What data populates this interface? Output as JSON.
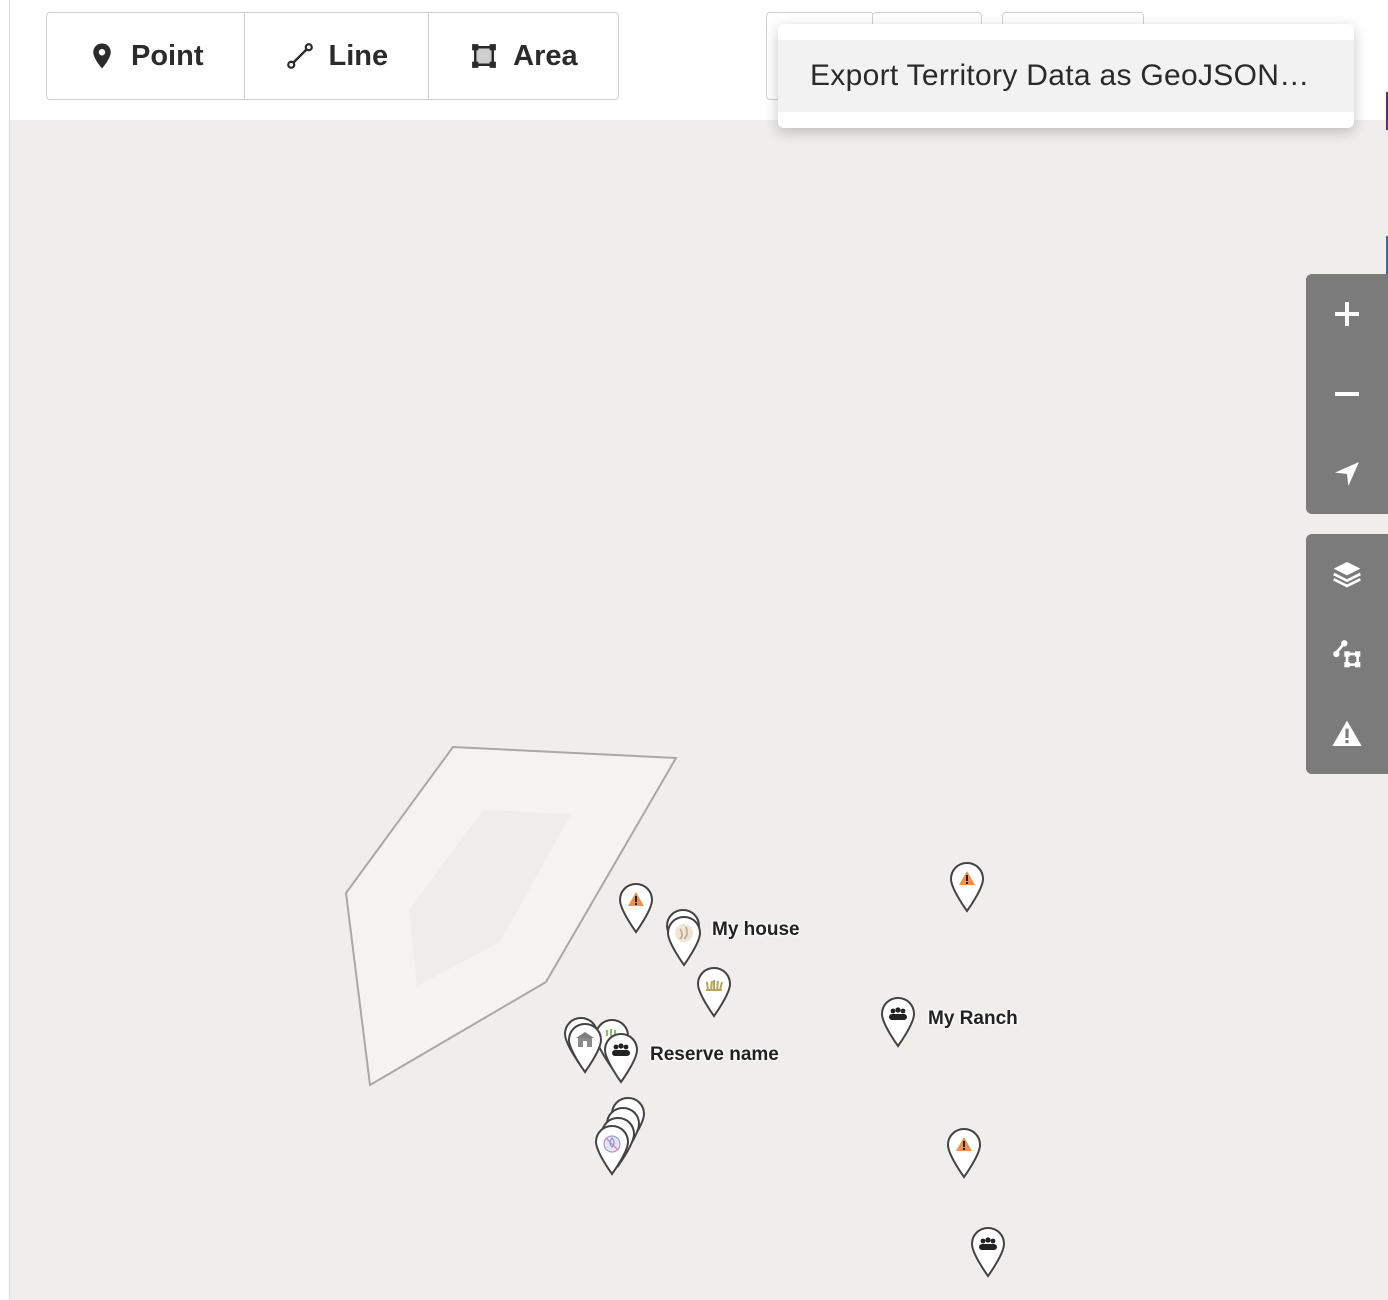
{
  "toolbar": {
    "draw_tools": [
      {
        "label": "Point",
        "icon": "map-pin-icon"
      },
      {
        "label": "Line",
        "icon": "line-icon"
      },
      {
        "label": "Area",
        "icon": "area-polygon-icon"
      }
    ]
  },
  "export_menu": {
    "items": [
      {
        "label": "Export Territory Data as GeoJSON…"
      }
    ]
  },
  "map": {
    "background_color": "#efeeea",
    "markers": [
      {
        "icon": "hazard-icon",
        "label": ""
      },
      {
        "icon": "house-icon",
        "label": "My house"
      },
      {
        "icon": "plant-icon",
        "label": ""
      },
      {
        "icon": "hazard-icon",
        "label": ""
      },
      {
        "icon": "community-icon",
        "label": "My Ranch"
      },
      {
        "icon": "building-icon",
        "label": ""
      },
      {
        "icon": "community-icon",
        "label": "Reserve name"
      },
      {
        "icon": "water-icon",
        "label": ""
      },
      {
        "icon": "hazard-icon",
        "label": ""
      },
      {
        "icon": "community-icon",
        "label": ""
      }
    ]
  },
  "map_controls": {
    "navigation": [
      "zoom-in-icon",
      "zoom-out-icon",
      "locate-icon"
    ],
    "tools": [
      "layers-icon",
      "draw-tool-icon",
      "alert-icon"
    ],
    "color": "#7b7b7b"
  }
}
